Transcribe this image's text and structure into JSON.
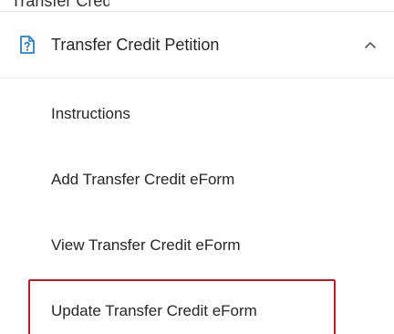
{
  "top_fragment": {
    "text": "Transfer Credit Petition"
  },
  "section": {
    "title": "Transfer Credit Petition",
    "icon": "document-question-icon",
    "chevron_icon": "chevron-up-icon",
    "expanded": true,
    "accent_color": "#2f7cc1"
  },
  "menu_items": [
    {
      "label": "Instructions"
    },
    {
      "label": "Add Transfer Credit eForm"
    },
    {
      "label": "View Transfer Credit eForm"
    },
    {
      "label": "Update Transfer Credit eForm"
    }
  ],
  "highlight": {
    "color": "#b0202a"
  }
}
